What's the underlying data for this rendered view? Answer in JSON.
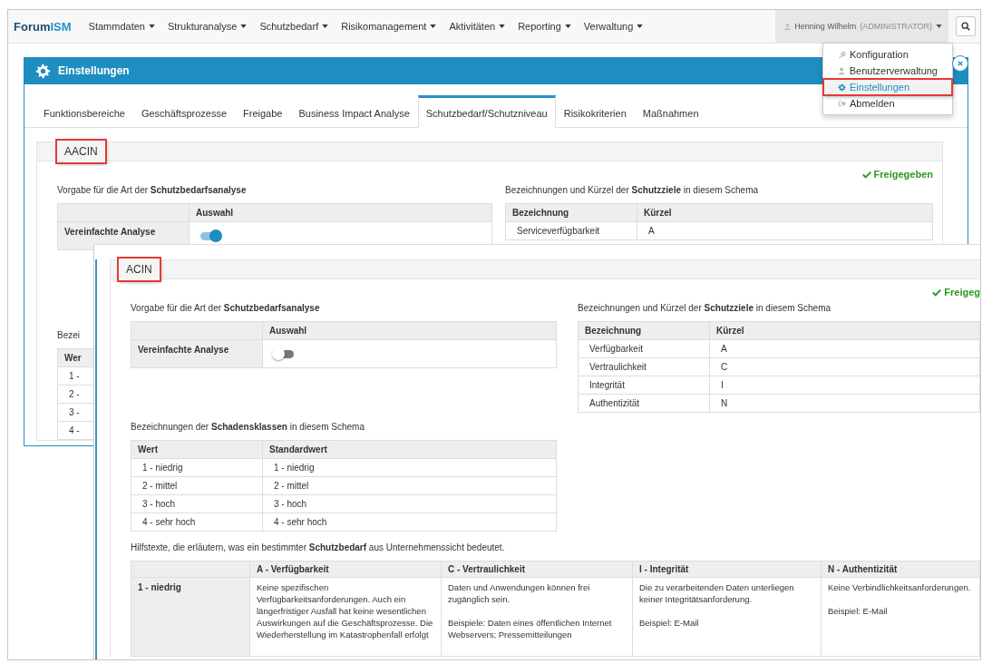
{
  "nav": {
    "logo": {
      "part_1": "Forum",
      "part_2": "ISM"
    },
    "menus": [
      "Stammdaten",
      "Strukturanalyse",
      "Schutzbedarf",
      "Risikomanagement",
      "Aktivitäten",
      "Reporting",
      "Verwaltung"
    ],
    "user": {
      "name": "Henning Wilhelm",
      "role": "(ADMINISTRATOR)"
    }
  },
  "user_menu": {
    "items": [
      {
        "label": "Konfiguration",
        "selected": false,
        "highlighted": false
      },
      {
        "label": "Benutzerverwaltung",
        "selected": false,
        "highlighted": false
      },
      {
        "label": "Einstellungen",
        "selected": true,
        "highlighted": true
      },
      {
        "label": "Abmelden",
        "selected": false,
        "highlighted": false
      }
    ]
  },
  "dialog": {
    "title": "Einstellungen",
    "tabs": [
      {
        "label": "Funktionsbereiche",
        "selected": false
      },
      {
        "label": "Geschäftsprozesse",
        "selected": false
      },
      {
        "label": "Freigabe",
        "selected": false
      },
      {
        "label": "Business Impact Analyse",
        "selected": false
      },
      {
        "label": "Schutzbedarf/Schutzniveau",
        "selected": true
      },
      {
        "label": "Risikokriterien",
        "selected": false
      },
      {
        "label": "Maßnahmen",
        "selected": false
      }
    ],
    "schema": {
      "name": "AACIN",
      "highlighted": true,
      "status": "Freigegeben",
      "analysis": {
        "intro": "Vorgabe für die Art der **Schutzbedarfsanalyse**",
        "column": "Auswahl",
        "row_label": "Vereinfachte Analyse",
        "on": true
      },
      "goals": {
        "intro": "Bezeichnungen und Kürzel der **Schutzziele** in diesem Schema",
        "columns": [
          "Bezeichnung",
          "Kürzel"
        ],
        "rows": [
          [
            "Serviceverfügbarkeit",
            "A"
          ]
        ]
      },
      "damage_classes": {
        "intro": "Bezei",
        "columns": [
          "Wer"
        ],
        "rows": [
          [
            "1 -"
          ],
          [
            "2 -"
          ],
          [
            "3 -"
          ],
          [
            "4 -"
          ]
        ]
      }
    }
  },
  "overlay_schema": {
    "name": "ACIN",
    "highlighted": true,
    "status": "Freigeg",
    "analysis": {
      "intro": "Vorgabe für die Art der **Schutzbedarfsanalyse**",
      "column": "Auswahl",
      "row_label": "Vereinfachte Analyse",
      "on": false
    },
    "goals": {
      "intro": "Bezeichnungen und Kürzel der **Schutzziele** in diesem Schema",
      "columns": [
        "Bezeichnung",
        "Kürzel"
      ],
      "rows": [
        [
          "Verfügbarkeit",
          "A"
        ],
        [
          "Vertraulichkeit",
          "C"
        ],
        [
          "Integrität",
          "I"
        ],
        [
          "Authentizität",
          "N"
        ]
      ]
    },
    "damage_classes": {
      "intro": "Bezeichnungen der **Schadensklassen** in diesem Schema",
      "columns": [
        "Wert",
        "Standardwert"
      ],
      "rows": [
        [
          "1 - niedrig",
          "1 - niedrig"
        ],
        [
          "2 - mittel",
          "2 - mittel"
        ],
        [
          "3 - hoch",
          "3 - hoch"
        ],
        [
          "4 - sehr hoch",
          "4 - sehr hoch"
        ]
      ]
    },
    "help_texts": {
      "intro": "Hilfstexte, die erläutern, was ein bestimmter **Schutzbedarf** aus Unternehmenssicht bedeutet.",
      "columns": [
        "A - Verfügbarkeit",
        "C - Vertraulichkeit",
        "I - Integrität",
        "N - Authentizität"
      ],
      "rows": [
        {
          "label": "1 - niedrig",
          "cells": [
            [
              "Keine spezifischen Verfügbarkeitsanforderungen. Auch ein längerfristiger Ausfall hat keine wesentlichen Auswirkungen auf die Geschäftsprozesse. Die Wiederherstellung im Katastrophenfall erfolgt"
            ],
            [
              "Daten und Anwendungen können frei zugänglich sein.",
              "Beispiele: Daten eines öffentlichen Internet Webservers; Pressemitteilungen"
            ],
            [
              "Die zu verarbeitenden Daten unterliegen keiner Integritätsanforderung.",
              "Beispiel: E-Mail"
            ],
            [
              "Keine Verbindlichkeitsanforderungen.",
              "Beispiel: E-Mail"
            ]
          ]
        }
      ]
    }
  }
}
